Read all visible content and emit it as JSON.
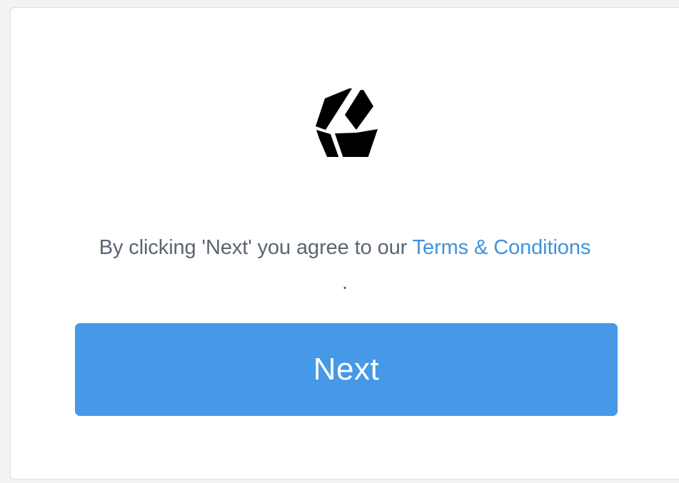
{
  "brand": {
    "logo_icon": "hexagon-stripes-logo-icon",
    "logo_color": "#000000"
  },
  "consent": {
    "prefix": "By clicking 'Next' you agree to our ",
    "link_text": "Terms & Conditions",
    "suffix": "."
  },
  "actions": {
    "next_label": "Next"
  },
  "colors": {
    "accent": "#4699e6",
    "link": "#3f92df",
    "text": "#5b6573",
    "card_background": "#ffffff"
  }
}
